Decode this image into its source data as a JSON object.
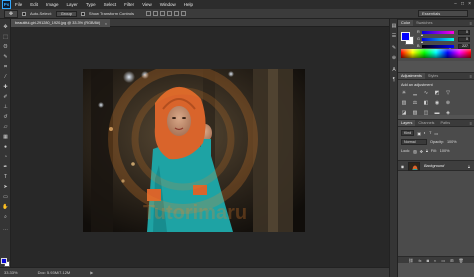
{
  "app": {
    "logo": "Ps"
  },
  "menu": [
    "File",
    "Edit",
    "Image",
    "Layer",
    "Type",
    "Select",
    "Filter",
    "View",
    "Window",
    "Help"
  ],
  "window_controls": [
    "−",
    "□",
    "×"
  ],
  "options": {
    "auto_select_label": "Auto-Select:",
    "auto_select_value": "Group",
    "transform_label": "Show Transform Controls",
    "workspace": "Essentials"
  },
  "document": {
    "tab_title": "beautiful-girl-291280_1920.jpg @ 33.3% (RGB/8#)",
    "close": "×",
    "watermark": "Tutorimaru"
  },
  "status": {
    "zoom": "33.33%",
    "doc_info": "Doc: 5.93M/7.12M"
  },
  "panels": {
    "color": {
      "tabs": [
        "Color",
        "Swatches"
      ],
      "fg": "#0000ff",
      "bg": "#ffffff",
      "sliders": [
        {
          "label": "R",
          "value": "0"
        },
        {
          "label": "G",
          "value": "0"
        },
        {
          "label": "B",
          "value": "227"
        }
      ]
    },
    "adjustments": {
      "tabs": [
        "Adjustments",
        "Styles"
      ],
      "title": "Add an adjustment"
    },
    "layers": {
      "tabs": [
        "Layers",
        "Channels",
        "Paths"
      ],
      "kind": "Kind",
      "blend": "Normal",
      "opacity_label": "Opacity:",
      "opacity": "100%",
      "lock_label": "Lock:",
      "fill_label": "Fill:",
      "fill": "100%",
      "layer_name": "Background"
    }
  },
  "colors": {
    "accent": "#31a8ff",
    "foreground": "#0000ff",
    "background": "#ffffff",
    "hijab": "#d9642b",
    "dress": "#1ea3a4",
    "watermark": "#e8822a"
  }
}
